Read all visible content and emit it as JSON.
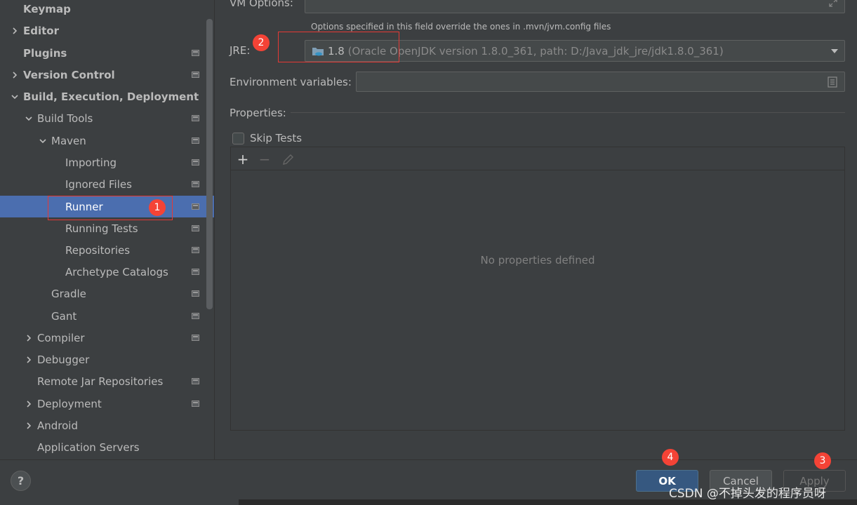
{
  "sidebar": {
    "items": [
      {
        "label": "Keymap",
        "bold": true
      },
      {
        "label": "Editor",
        "bold": true
      },
      {
        "label": "Plugins",
        "bold": true
      },
      {
        "label": "Version Control",
        "bold": true
      },
      {
        "label": "Build, Execution, Deployment",
        "bold": true
      },
      {
        "label": "Build Tools"
      },
      {
        "label": "Maven"
      },
      {
        "label": "Importing"
      },
      {
        "label": "Ignored Files"
      },
      {
        "label": "Runner",
        "selected": true
      },
      {
        "label": "Running Tests"
      },
      {
        "label": "Repositories"
      },
      {
        "label": "Archetype Catalogs"
      },
      {
        "label": "Gradle"
      },
      {
        "label": "Gant"
      },
      {
        "label": "Compiler"
      },
      {
        "label": "Debugger"
      },
      {
        "label": "Remote Jar Repositories"
      },
      {
        "label": "Deployment"
      },
      {
        "label": "Android"
      },
      {
        "label": "Application Servers"
      }
    ]
  },
  "main": {
    "vm_options_label": "VM Options:",
    "vm_options_hint": "Options specified in this field override the ones in .mvn/jvm.config files",
    "jre_label": "JRE:",
    "jre_version": "1.8",
    "jre_detail": " (Oracle OpenJDK version 1.8.0_361, path: D:/Java_jdk_jre/jdk1.8.0_361)",
    "env_label": "Environment variables:",
    "properties_label": "Properties:",
    "skip_tests_label": "Skip Tests",
    "add_symbol": "+",
    "remove_symbol": "−",
    "empty_text": "No properties defined"
  },
  "footer": {
    "help": "?",
    "ok": "OK",
    "cancel": "Cancel",
    "apply": "Apply"
  },
  "annotations": {
    "badge1": "1",
    "badge2": "2",
    "badge3": "3",
    "badge4": "4"
  },
  "watermark": "CSDN @不掉头发的程序员呀",
  "colors": {
    "background": "#3c3f41",
    "selection": "#4b6eaf",
    "default_button": "#365880",
    "annotation_red": "#e53935"
  }
}
